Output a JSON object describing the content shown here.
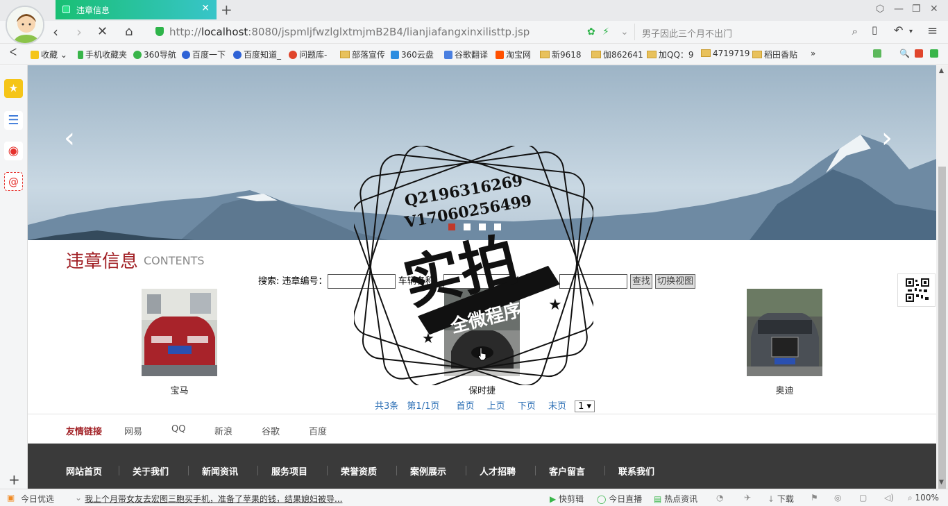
{
  "browser": {
    "tab_title": "违章信息",
    "url_prefix": "http://",
    "url_host": "localhost",
    "url_path": ":8080/jspmljfwzlglxtmjmB2B4/lianjiafangxinxilisttp.jsp",
    "search_placeholder": "男子因此三个月不出门",
    "bookmarks": [
      "收藏",
      "手机收藏夹",
      "360导航",
      "百度一下",
      "百度知道_",
      "问题库-",
      "部落宣传",
      "360云盘",
      "谷歌翻译",
      "淘宝网",
      "新9618",
      "伽862641",
      "加QQ：9",
      "4719719",
      "稻田香贴"
    ]
  },
  "page": {
    "section_title": "违章信息",
    "section_subtitle": "CONTENTS",
    "search": {
      "prefix": "搜索:",
      "field1_label": "违章编号：",
      "field2_label": "车辆名称：",
      "field3_label": "车辆颜色：",
      "field1_value": "",
      "field2_value": "",
      "field3_value": "",
      "find_button": "查找",
      "switch_button": "切换视图"
    },
    "cars": [
      {
        "name": "宝马",
        "body_color": "#a8232a"
      },
      {
        "name": "保时捷",
        "body_color": "#2a2a2a"
      },
      {
        "name": "奥迪",
        "body_color": "#4a4f55"
      }
    ],
    "pager": {
      "total": "共3条",
      "page": "第1/1页",
      "first": "首页",
      "prev": "上页",
      "next": "下页",
      "last": "末页",
      "select_value": "1 ▾"
    },
    "friend_links": {
      "title": "友情链接",
      "links": [
        "网易",
        "QQ",
        "新浪",
        "谷歌",
        "百度"
      ]
    },
    "footer_links": [
      "网站首页",
      "关于我们",
      "新闻资讯",
      "服务项目",
      "荣誉资质",
      "案例展示",
      "人才招聘",
      "客户留言",
      "联系我们"
    ]
  },
  "watermark": {
    "line1": "Q2196316269",
    "line2": "V17060256499",
    "big": "实拍",
    "ribbon": "全微程序"
  },
  "statusbar": {
    "left": "今日优选",
    "news": "我上个月带女友去宏图三胞买手机，准备了苹果的钱，结果媳妇被导...",
    "items": [
      "快剪辑",
      "今日直播",
      "热点资讯",
      "下载",
      "100%"
    ]
  },
  "colors": {
    "accent": "#a11f24",
    "footer_bg": "#3a3a3a",
    "link_blue": "#2c6fb5",
    "tab_green": "#19bf73"
  }
}
